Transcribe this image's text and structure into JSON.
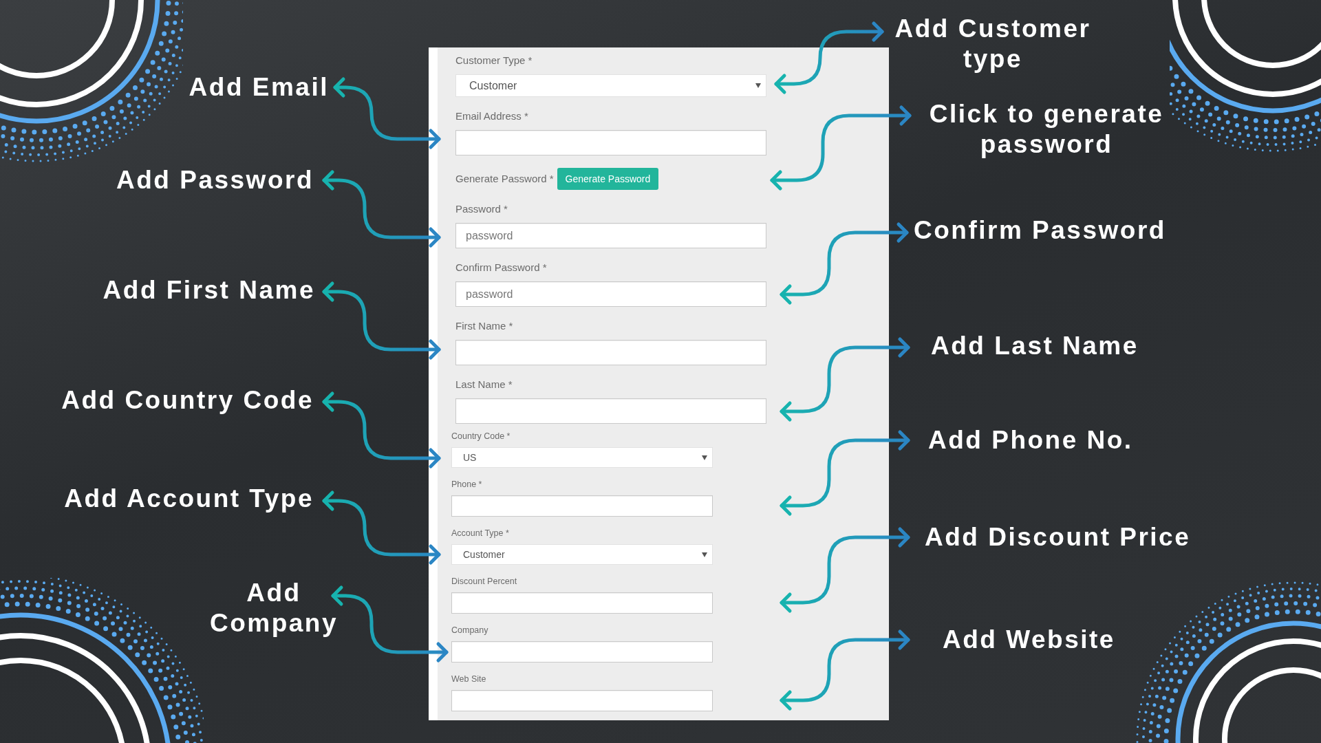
{
  "form": {
    "sections": [
      {
        "kind": "wide",
        "fields": [
          {
            "kind": "select",
            "label": "Customer Type *",
            "value": "Customer"
          },
          {
            "kind": "input",
            "label": "Email Address *"
          },
          {
            "kind": "action",
            "label": "Generate Password *",
            "button": "Generate Password"
          },
          {
            "kind": "input",
            "label": "Password *",
            "placeholder": "password"
          },
          {
            "kind": "input",
            "label": "Confirm Password *",
            "placeholder": "password"
          },
          {
            "kind": "input",
            "label": "First Name *"
          },
          {
            "kind": "input",
            "label": "Last Name *"
          }
        ]
      },
      {
        "kind": "compact",
        "fields": [
          {
            "kind": "select",
            "label": "Country Code *",
            "value": "US"
          },
          {
            "kind": "input",
            "label": "Phone *"
          },
          {
            "kind": "select",
            "label": "Account Type *",
            "value": "Customer"
          },
          {
            "kind": "input",
            "label": "Discount Percent"
          },
          {
            "kind": "input",
            "label": "Company"
          },
          {
            "kind": "input",
            "label": "Web Site"
          }
        ]
      }
    ]
  },
  "annotations": {
    "left": [
      "Add Email",
      "Add Password",
      "Add First Name",
      "Add Country Code",
      "Add Account Type",
      "Add Company"
    ],
    "right": [
      "Add Customer type",
      "Click to generate password",
      "Confirm Password",
      "Add Last Name",
      "Add Phone No.",
      "Add Discount Price",
      "Add Website"
    ]
  }
}
